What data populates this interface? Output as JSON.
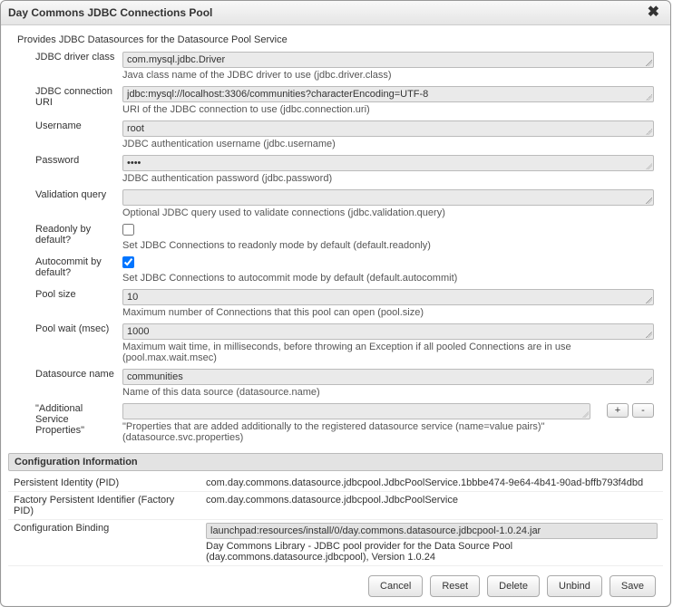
{
  "dialog": {
    "title": "Day Commons JDBC Connections Pool",
    "description": "Provides JDBC Datasources for the Datasource Pool Service"
  },
  "fields": {
    "driver": {
      "label": "JDBC driver class",
      "value": "com.mysql.jdbc.Driver",
      "hint": "Java class name of the JDBC driver to use (jdbc.driver.class)"
    },
    "uri": {
      "label": "JDBC connection URI",
      "value": "jdbc:mysql://localhost:3306/communities?characterEncoding=UTF-8",
      "hint": "URI of the JDBC connection to use (jdbc.connection.uri)"
    },
    "username": {
      "label": "Username",
      "value": "root",
      "hint": "JDBC authentication username (jdbc.username)"
    },
    "password": {
      "label": "Password",
      "value": "••••",
      "hint": "JDBC authentication password (jdbc.password)"
    },
    "validation": {
      "label": "Validation query",
      "value": "",
      "hint": "Optional JDBC query used to validate connections (jdbc.validation.query)"
    },
    "readonly": {
      "label": "Readonly by default?",
      "checked": false,
      "hint": "Set JDBC Connections to readonly mode by default (default.readonly)"
    },
    "autocommit": {
      "label": "Autocommit by default?",
      "checked": true,
      "hint": "Set JDBC Connections to autocommit mode by default (default.autocommit)"
    },
    "poolsize": {
      "label": "Pool size",
      "value": "10",
      "hint": "Maximum number of Connections that this pool can open (pool.size)"
    },
    "poolwait": {
      "label": "Pool wait (msec)",
      "value": "1000",
      "hint": "Maximum wait time, in milliseconds, before throwing an Exception if all pooled Connections are in use (pool.max.wait.msec)"
    },
    "dsname": {
      "label": "Datasource name",
      "value": "communities",
      "hint": "Name of this data source (datasource.name)"
    },
    "additional": {
      "label": "\"Additional Service Properties\"",
      "value": "",
      "hint": "\"Properties that are added additionally to the registered datasource service (name=value pairs)\" (datasource.svc.properties)"
    }
  },
  "configInfo": {
    "header": "Configuration Information",
    "pid": {
      "label": "Persistent Identity (PID)",
      "value": "com.day.commons.datasource.jdbcpool.JdbcPoolService.1bbbe474-9e64-4b41-90ad-bffb793f4dbd"
    },
    "fpid": {
      "label": "Factory Persistent Identifier (Factory PID)",
      "value": "com.day.commons.datasource.jdbcpool.JdbcPoolService"
    },
    "binding": {
      "label": "Configuration Binding",
      "value": "launchpad:resources/install/0/day.commons.datasource.jdbcpool-1.0.24.jar",
      "desc": "Day Commons Library - JDBC pool provider for the Data Source Pool (day.commons.datasource.jdbcpool), Version 1.0.24"
    }
  },
  "buttons": {
    "add": "+",
    "remove": "-",
    "cancel": "Cancel",
    "reset": "Reset",
    "delete": "Delete",
    "unbind": "Unbind",
    "save": "Save"
  }
}
